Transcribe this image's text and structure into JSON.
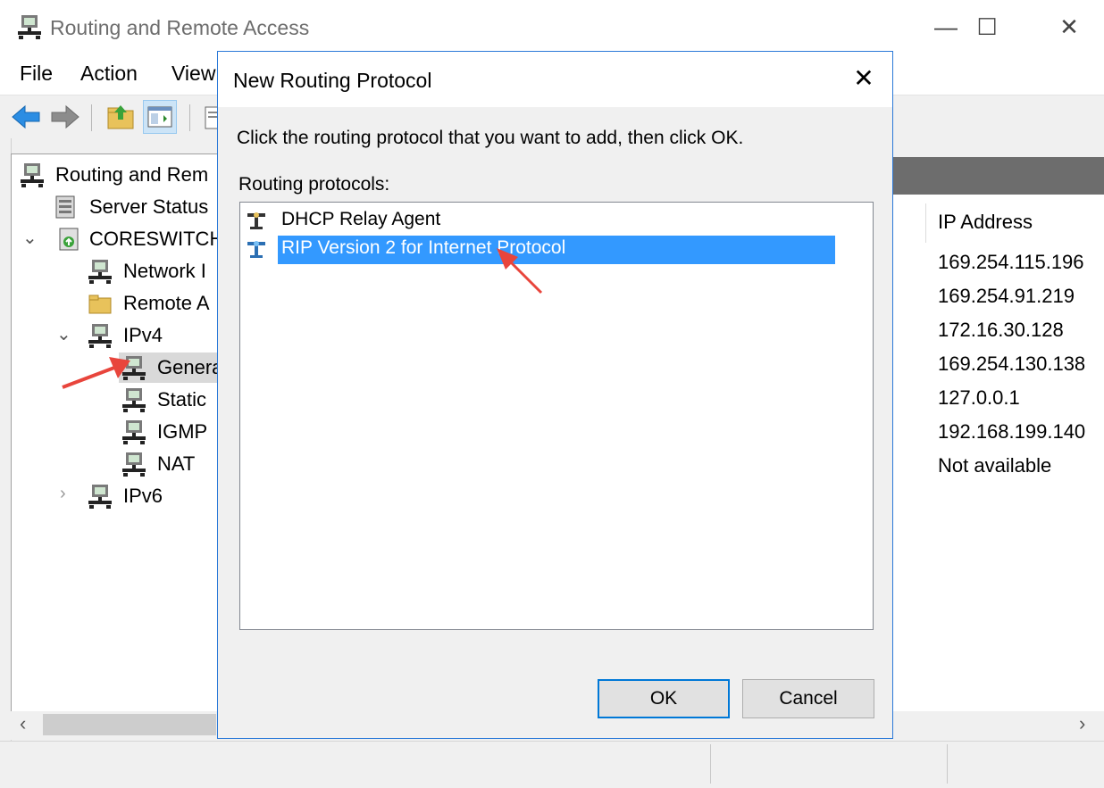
{
  "window": {
    "title": "Routing and Remote Access",
    "controls": [
      "minimize",
      "maximize",
      "close"
    ]
  },
  "menu": {
    "file": "File",
    "action": "Action",
    "view": "View"
  },
  "tree": {
    "root": "Routing and Rem",
    "server_status": "Server Status",
    "server": "CORESWITCH",
    "network": "Network I",
    "remote": "Remote A",
    "ipv4": "IPv4",
    "general": "Genera",
    "static": "Static",
    "igmp": "IGMP",
    "nat": "NAT",
    "ipv6": "IPv6"
  },
  "right_pane": {
    "column_header": "IP Address",
    "rows": [
      "169.254.115.196",
      "169.254.91.219",
      "172.16.30.128",
      "169.254.130.138",
      "127.0.0.1",
      "192.168.199.140",
      "Not available"
    ]
  },
  "dialog": {
    "title": "New Routing Protocol",
    "instruction": "Click the routing protocol that you want to add, then click OK.",
    "list_label": "Routing protocols:",
    "protocols": [
      "DHCP Relay Agent",
      "RIP Version 2 for Internet Protocol"
    ],
    "selected_index": 1,
    "ok_label": "OK",
    "cancel_label": "Cancel"
  },
  "colors": {
    "selection": "#3399ff",
    "dialog_border": "#2b79d8",
    "annotation_arrow": "#e8453c",
    "ok_focus": "#0078d7"
  }
}
